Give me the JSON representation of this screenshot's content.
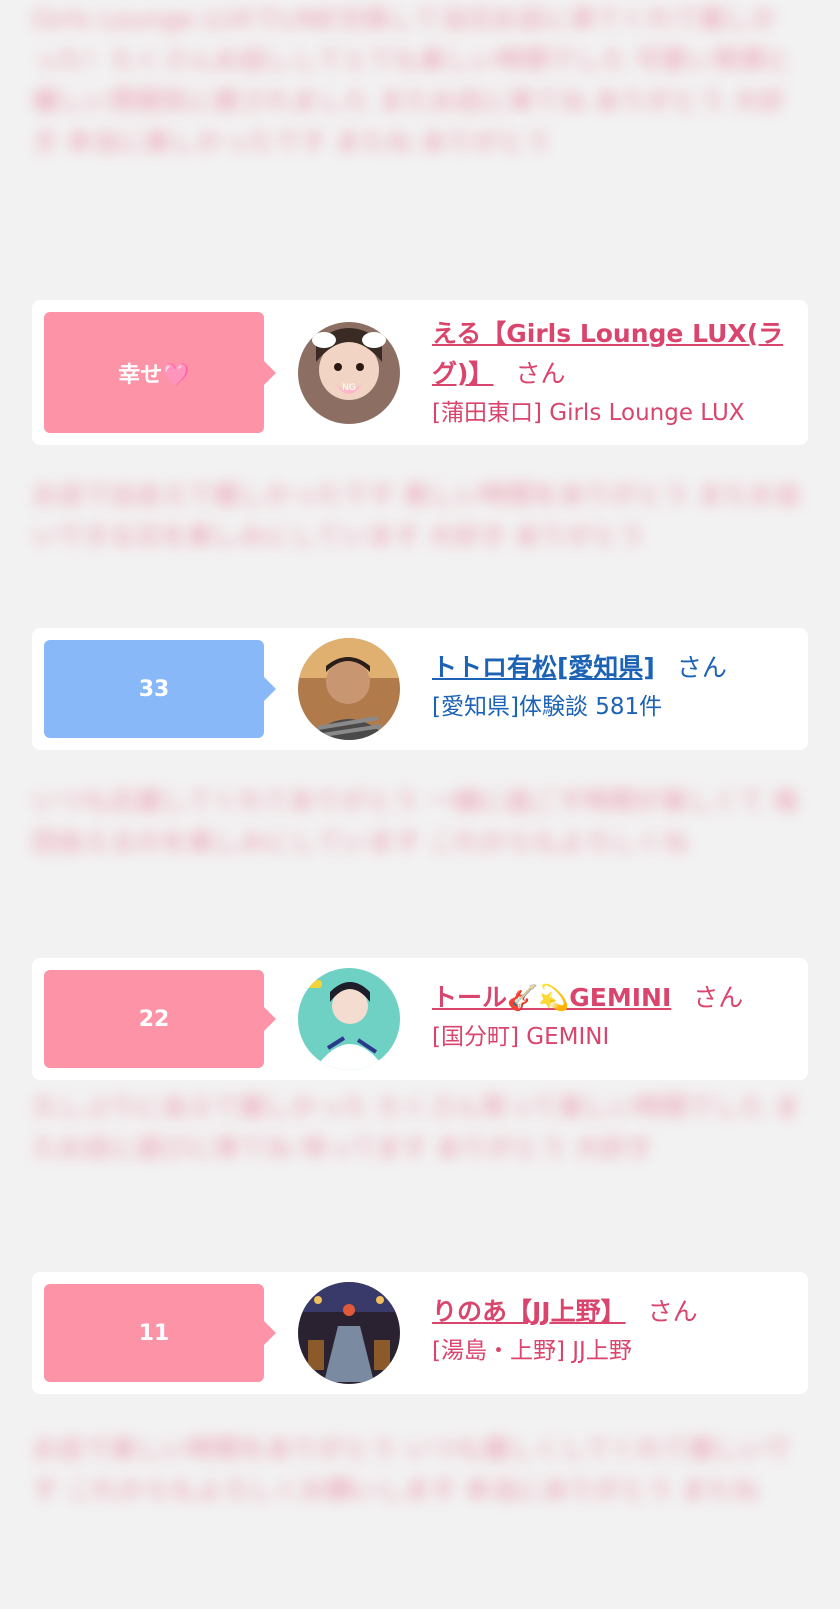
{
  "blurred_texts": [
    "Girls Lounge LUXでLINE交換して当日お店に来てくれて嬉しかった！たくさんお話ししてとても楽しい時間でした 可愛い笑顔と優しい雰囲気に癒されました またお店に来てね ありがとう 大好き 本当に楽しかったです またね ありがとう",
    "お店で出会えて嬉しかったです 楽しい時間をありがとう またお会いできる日を楽しみにしています 大好き ありがとう",
    "いつも応援してくれてありがとう 一緒に過ごす時間が楽しくて 毎回会えるのを楽しみにしています これからもよろしくね",
    "久しぶりに会えて嬉しかった たくさん笑って楽しい時間でした またお店に遊びに来てね 待ってます ありがとう 大好き",
    "お店で楽しい時間をありがとう いつも優しくしてくれて嬉しいです これからもよろしくお願いします 本当にありがとう またね"
  ],
  "cards": [
    {
      "tag": "幸せ🩷",
      "tag_color": "#fc93a7",
      "name": "える【Girls Lounge LUX(ラグ)】",
      "honorific": "さん",
      "detail": "[蒲田東口] Girls Lounge LUX",
      "text_color": "#d9456d"
    },
    {
      "tag": "33",
      "tag_color": "#88b8f7",
      "name": "トトロ有松[愛知県]",
      "honorific": "さん",
      "detail": "[愛知県]体験談 581件",
      "text_color": "#1d63b5"
    },
    {
      "tag": "22",
      "tag_color": "#fc93a7",
      "name": "トール🎸💫GEMINI",
      "honorific": "さん",
      "detail": "[国分町] GEMINI",
      "text_color": "#d9456d"
    },
    {
      "tag": "11",
      "tag_color": "#fc93a7",
      "name": "りのあ【JJ上野】",
      "honorific": "さん",
      "detail": "[湯島・上野] JJ上野",
      "text_color": "#d9456d"
    }
  ],
  "icons": {
    "avatar_1": "girl-photo-avatar",
    "avatar_2": "man-photo-avatar",
    "avatar_3": "illustration-avatar",
    "avatar_4": "venue-photo-avatar"
  }
}
